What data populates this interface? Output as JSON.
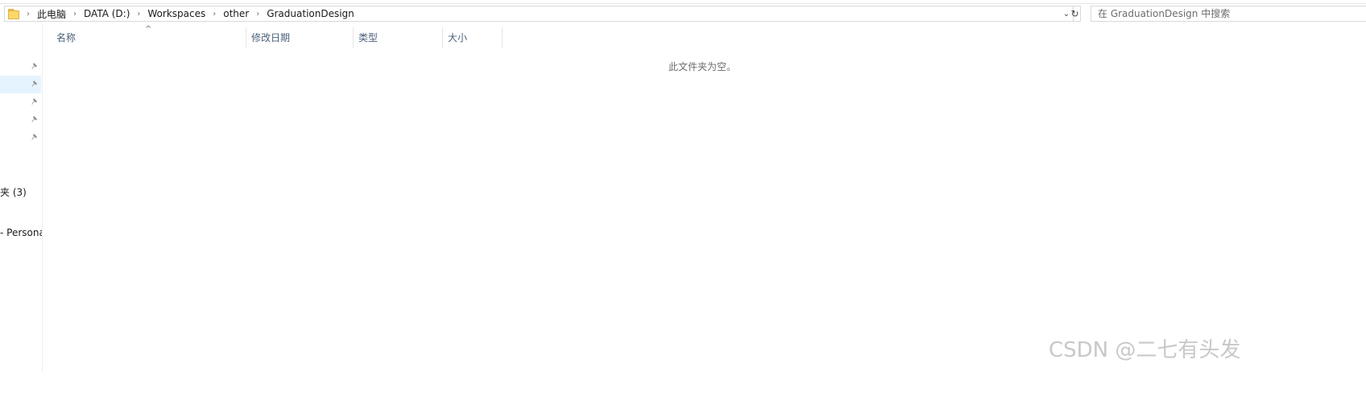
{
  "address_bar": {
    "crumbs": [
      "此电脑",
      "DATA (D:)",
      "Workspaces",
      "other",
      "GraduationDesign"
    ],
    "separator": "›",
    "dropdown_glyph": "⌄",
    "refresh_glyph": "↻"
  },
  "search": {
    "placeholder": "在 GraduationDesign 中搜索"
  },
  "nav_pane": {
    "pinned_count": 5,
    "items": [
      {
        "label": "夹 (3)"
      },
      {
        "label": "- Persona"
      }
    ]
  },
  "columns": {
    "name": "名称",
    "modified": "修改日期",
    "type": "类型",
    "size": "大小",
    "sort_glyph": "^"
  },
  "content": {
    "empty_message": "此文件夹为空。"
  },
  "watermark": "CSDN @二七有头发",
  "icons": {
    "folder": "folder-icon",
    "pin": "pin-icon",
    "refresh": "refresh-icon",
    "dropdown": "chevron-down-icon"
  }
}
